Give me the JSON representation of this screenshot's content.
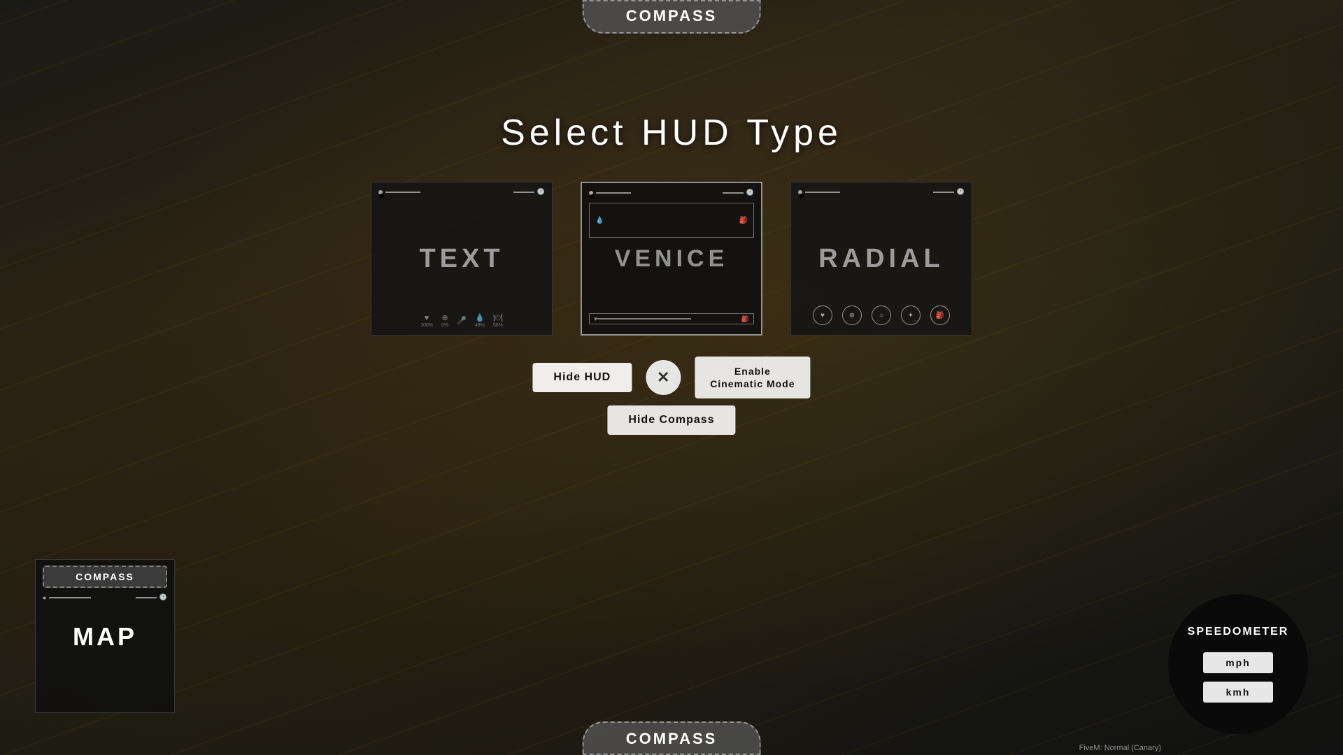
{
  "app": {
    "title": "COMPASS"
  },
  "header": {
    "compass_label": "COMPASS"
  },
  "page": {
    "title": "Select HUD Type"
  },
  "hud_cards": [
    {
      "id": "text",
      "label": "TEXT",
      "active": false
    },
    {
      "id": "venice",
      "label": "VENICE",
      "active": true
    },
    {
      "id": "radial",
      "label": "RADIAL",
      "active": false
    }
  ],
  "buttons": {
    "hide_hud": "Hide HUD",
    "close": "✕",
    "enable_cinematic": "Enable\nCinematic Mode",
    "hide_compass": "Hide Compass"
  },
  "map_widget": {
    "compass_label": "COMPASS",
    "title": "MAP"
  },
  "speedometer_widget": {
    "label": "SPEEDOMETER",
    "btn_mph": "mph",
    "btn_kmh": "kmh"
  },
  "footer": {
    "compass_label": "CoMPAss",
    "bottom_compass": "COMPASS"
  },
  "version": {
    "text": "FiveM: Normal (Canary)"
  }
}
